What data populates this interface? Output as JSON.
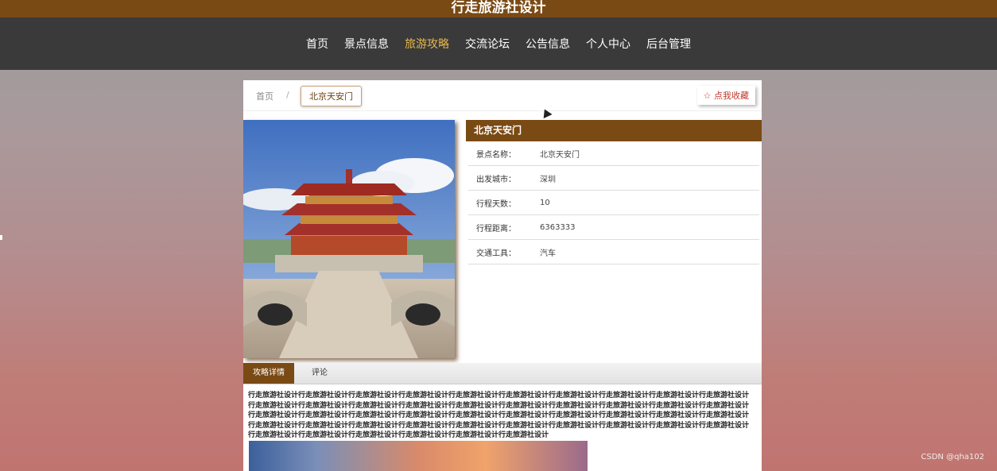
{
  "site": {
    "title": "行走旅游社设计"
  },
  "nav": {
    "items": [
      {
        "label": "首页"
      },
      {
        "label": "景点信息"
      },
      {
        "label": "旅游攻略"
      },
      {
        "label": "交流论坛"
      },
      {
        "label": "公告信息"
      },
      {
        "label": "个人中心"
      },
      {
        "label": "后台管理"
      }
    ],
    "active_index": 2
  },
  "breadcrumb": {
    "home": "首页",
    "separator": "/",
    "current": "北京天安门"
  },
  "favorite": {
    "label": "☆ 点我收藏"
  },
  "info": {
    "title": "北京天安门",
    "rows": [
      {
        "label": "景点名称：",
        "value": "北京天安门"
      },
      {
        "label": "出发城市：",
        "value": "深圳"
      },
      {
        "label": "行程天数：",
        "value": "10"
      },
      {
        "label": "行程距离：",
        "value": "6363333"
      },
      {
        "label": "交通工具：",
        "value": "汽车"
      }
    ]
  },
  "tabs": [
    {
      "label": "攻略详情"
    },
    {
      "label": "评论"
    }
  ],
  "detail": {
    "text": "行走旅游社设计行走旅游社设计行走旅游社设计行走旅游社设计行走旅游社设计行走旅游社设计行走旅游社设计行走旅游社设计行走旅游社设计行走旅游社设计行走旅游社设计行走旅游社设计行走旅游社设计行走旅游社设计行走旅游社设计行走旅游社设计行走旅游社设计行走旅游社设计行走旅游社设计行走旅游社设计行走旅游社设计行走旅游社设计行走旅游社设计行走旅游社设计行走旅游社设计行走旅游社设计行走旅游社设计行走旅游社设计行走旅游社设计行走旅游社设计行走旅游社设计行走旅游社设计行走旅游社设计行走旅游社设计行走旅游社设计行走旅游社设计行走旅游社设计行走旅游社设计行走旅游社设计行走旅游社设计行走旅游社设计行走旅游社设计行走旅游社设计行走旅游社设计行走旅游社设计行走旅游社设计"
  },
  "watermark": "CSDN @qha102",
  "colors": {
    "brand_brown": "#7a4a14",
    "nav_bg": "#3a3a3a",
    "nav_active": "#e6b84a",
    "favorite_red": "#c0392b"
  }
}
